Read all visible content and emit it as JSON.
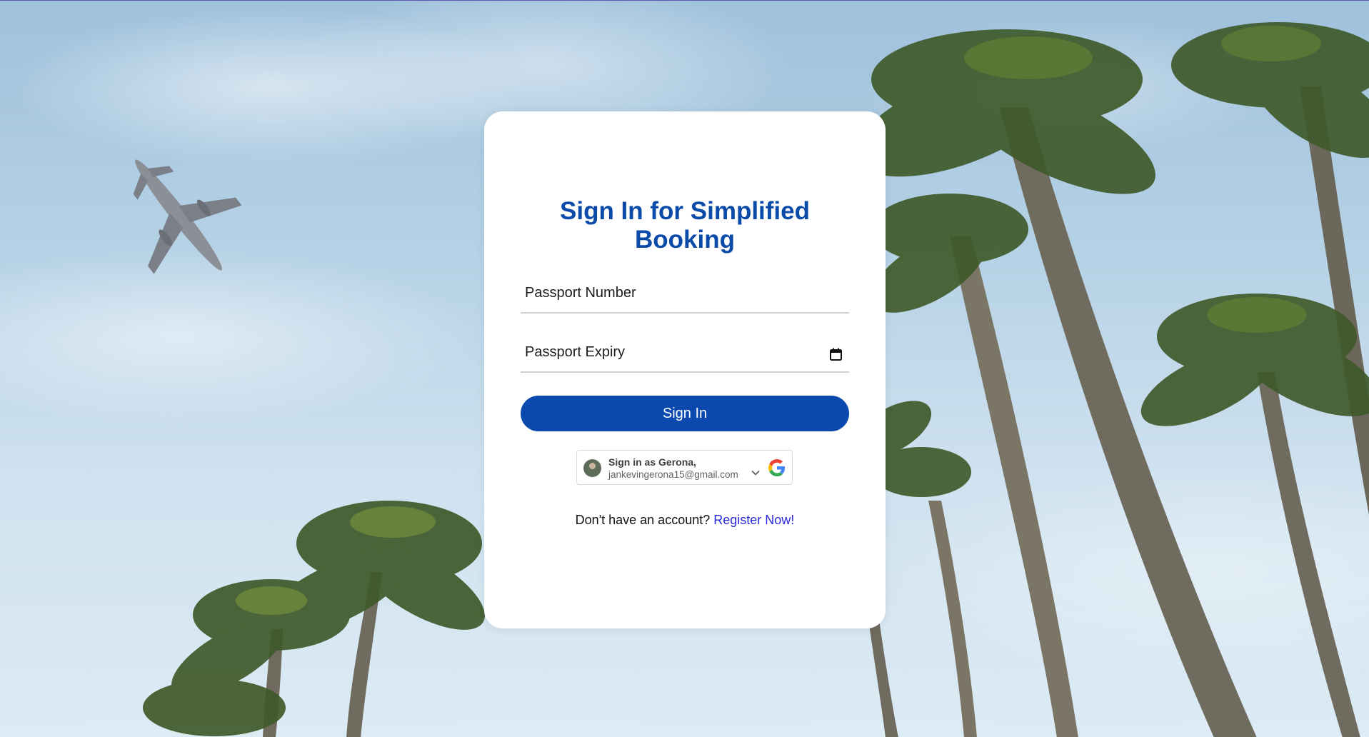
{
  "page": {
    "background": "sky-with-palm-trees-and-airplane",
    "accent_color": "#0b49ae"
  },
  "login": {
    "title_line1": "Sign In for Simplified",
    "title_line2": "Booking",
    "passport_number_label": "Passport Number",
    "passport_expiry_label": "Passport Expiry",
    "calendar_icon": "calendar-icon",
    "signin_label": "Sign In",
    "google": {
      "name_text": "Sign in as Gerona,",
      "email_text": "jankevingerona15@gmail.com",
      "chevron_icon": "chevron-down-icon",
      "logo_icon": "google-g-icon"
    },
    "register_prompt": "Don't have an account?",
    "register_link": "Register Now!"
  }
}
